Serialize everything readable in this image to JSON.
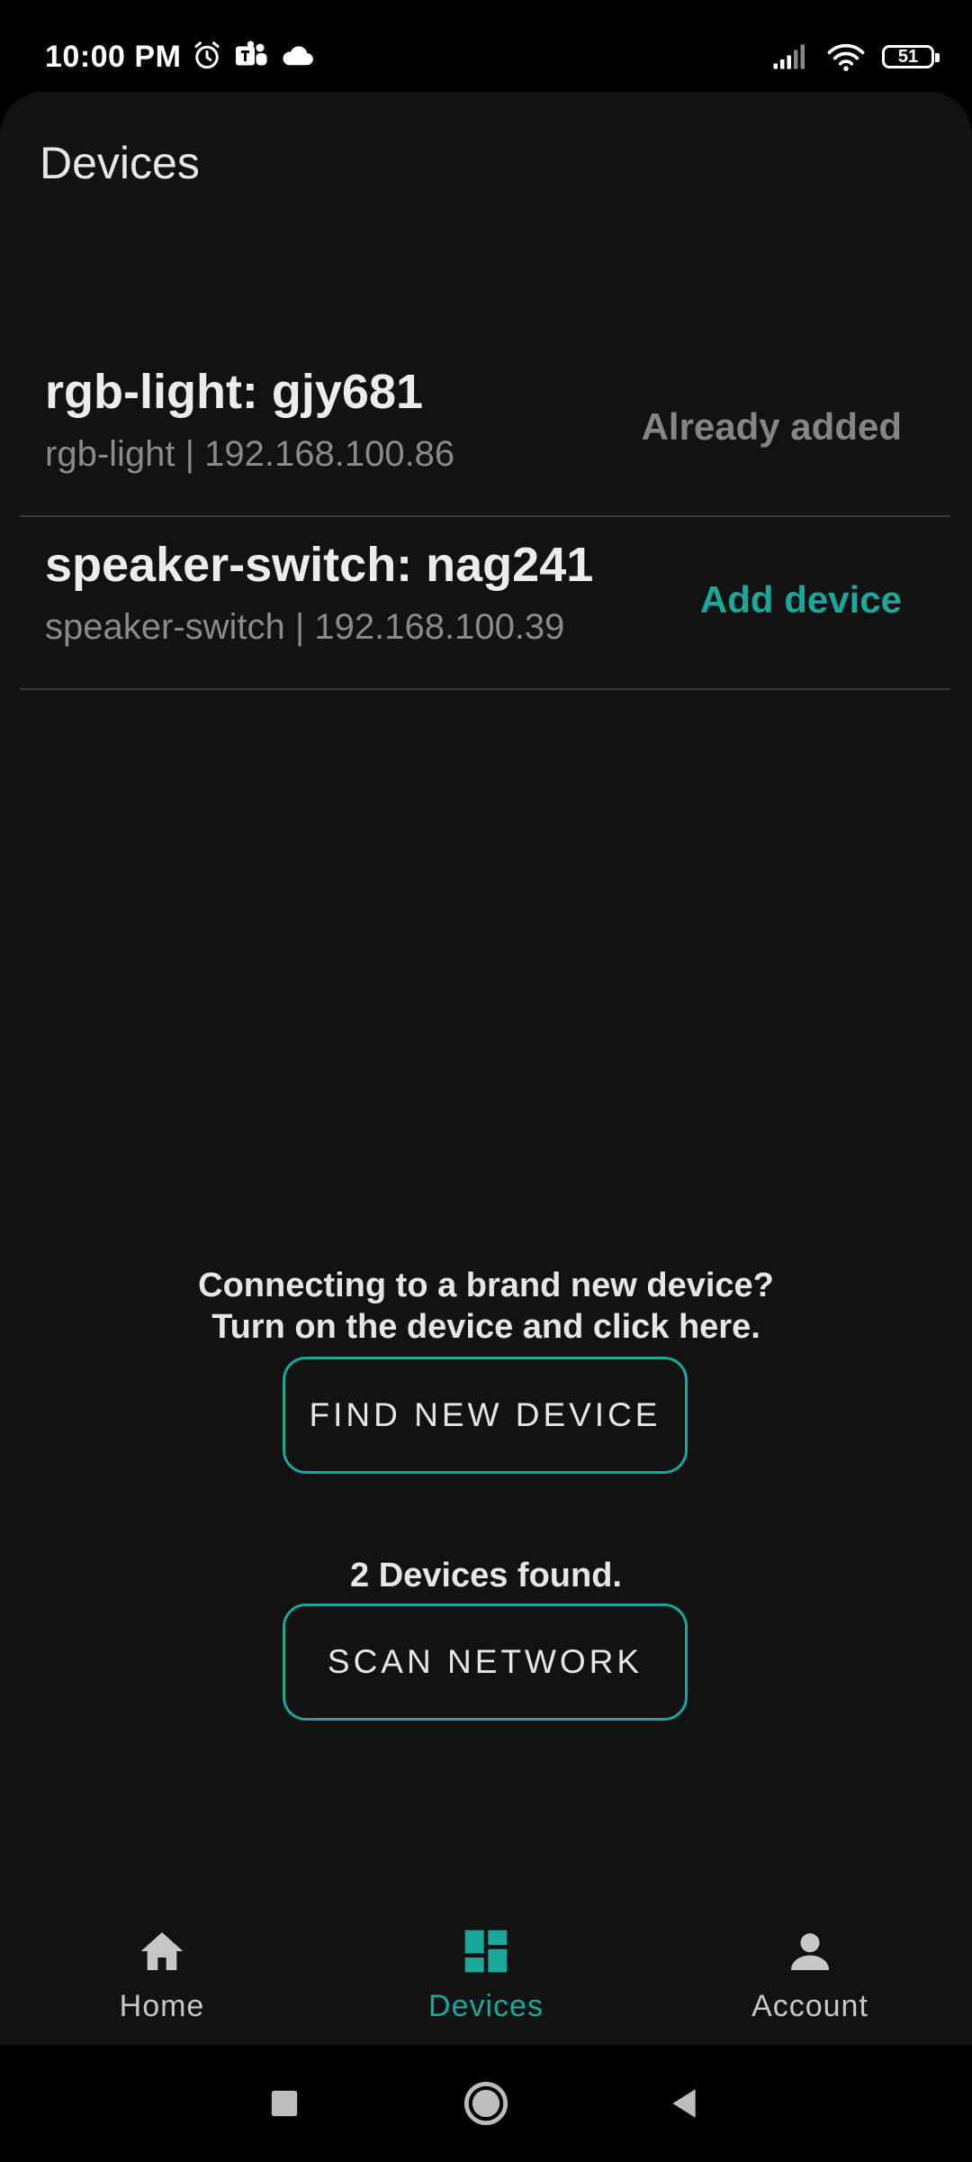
{
  "status_bar": {
    "time": "10:00 PM",
    "battery": "51",
    "left_icons": [
      "alarm-icon",
      "teams-icon",
      "cloud-icon"
    ],
    "right_icons": [
      "signal-icon",
      "wifi-icon",
      "battery-icon"
    ]
  },
  "header": {
    "title": "Devices"
  },
  "devices": [
    {
      "name": "rgb-light: gjy681",
      "subtitle": "rgb-light | 192.168.100.86",
      "action": "Already added"
    },
    {
      "name": "speaker-switch: nag241",
      "subtitle": "speaker-switch | 192.168.100.39",
      "action": "Add device"
    }
  ],
  "find_section": {
    "hint_line1": "Connecting to a brand new device?",
    "hint_line2": "Turn on the device and click here.",
    "button_label": "FIND NEW DEVICE"
  },
  "scan_section": {
    "status": "2 Devices found.",
    "button_label": "SCAN NETWORK"
  },
  "bottom_nav": {
    "items": [
      {
        "label": "Home",
        "icon": "home-icon",
        "active": false
      },
      {
        "label": "Devices",
        "icon": "dashboard-icon",
        "active": true
      },
      {
        "label": "Account",
        "icon": "person-icon",
        "active": false
      }
    ]
  },
  "colors": {
    "accent": "#1aa89d",
    "background": "#121212",
    "muted_text": "#8a8a8a"
  }
}
